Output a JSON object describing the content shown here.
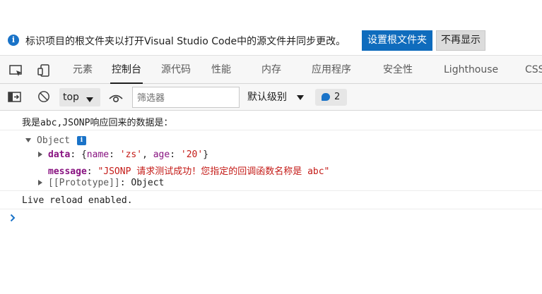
{
  "infobar": {
    "icon": "info-icon",
    "message": "标识项目的根文件夹以打开Visual Studio Code中的源文件并同步更改。",
    "primary_button": "设置根文件夹",
    "secondary_button": "不再显示"
  },
  "tabs": {
    "icons": [
      "inspect-element-icon",
      "device-emulation-icon"
    ],
    "items": [
      {
        "label": "元素",
        "active": false
      },
      {
        "label": "控制台",
        "active": true
      },
      {
        "label": "源代码",
        "active": false
      },
      {
        "label": "性能",
        "active": false
      },
      {
        "label": "内存",
        "active": false
      },
      {
        "label": "应用程序",
        "active": false
      },
      {
        "label": "安全性",
        "active": false
      },
      {
        "label": "Lighthouse",
        "active": false
      },
      {
        "label": "CSS",
        "active": false
      }
    ]
  },
  "toolbar": {
    "icons": [
      "show-sidebar-icon",
      "clear-console-icon",
      "live-expression-eye-icon"
    ],
    "context": "top",
    "filter_placeholder": "筛选器",
    "level": "默认级别",
    "message_count": "2",
    "message_icon": "message-bubble-icon"
  },
  "console": {
    "log_line": "我是abc,JSONP响应回来的数据是：",
    "object_label": "Object",
    "object_icon": "info-icon",
    "data_key": "data",
    "data_open": ": {",
    "name_key": "name",
    "name_value": "'zs'",
    "age_key": "age",
    "age_value": "'20'",
    "data_close": "}",
    "message_key": "message",
    "message_value": "\"JSONP 请求测试成功！您指定的回调函数名称是 abc\"",
    "prototype_key": "[[Prototype]]",
    "prototype_value": "Object",
    "reload_line": "Live reload enabled.",
    "prompt_icon": "chevron-right-icon"
  },
  "colors": {
    "primary": "#0f6cbd",
    "key": "#881280",
    "string": "#c41a16",
    "badge": "#1a73c8"
  }
}
